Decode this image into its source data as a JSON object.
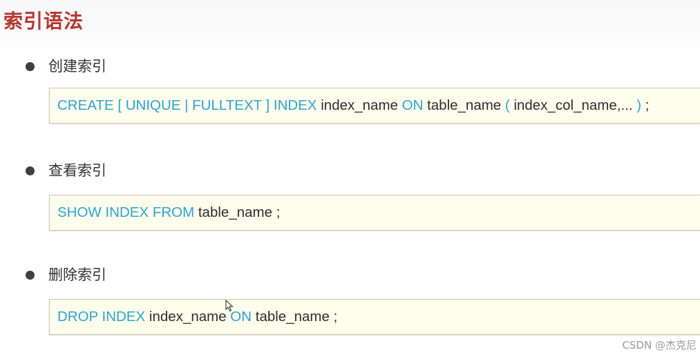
{
  "page": {
    "title": "索引语法",
    "title_color": "#b8352f",
    "keyword_color": "#26a5dc"
  },
  "sections": [
    {
      "label": "创建索引",
      "code": [
        {
          "t": "CREATE [ UNIQUE | FULLTEXT ] INDEX ",
          "kw": true
        },
        {
          "t": "index_name ",
          "kw": false
        },
        {
          "t": "ON ",
          "kw": true
        },
        {
          "t": "table_name ",
          "kw": false
        },
        {
          "t": "( ",
          "kw": true
        },
        {
          "t": "index_col_name,... ",
          "kw": false
        },
        {
          "t": ") ",
          "kw": true
        },
        {
          "t": ";",
          "kw": false
        }
      ]
    },
    {
      "label": "查看索引",
      "code": [
        {
          "t": "SHOW INDEX FROM ",
          "kw": true
        },
        {
          "t": "table_name ;",
          "kw": false
        }
      ]
    },
    {
      "label": "删除索引",
      "code": [
        {
          "t": "DROP INDEX ",
          "kw": true
        },
        {
          "t": "index_name ",
          "kw": false
        },
        {
          "t": "ON ",
          "kw": true
        },
        {
          "t": "table_name ;",
          "kw": false
        }
      ]
    }
  ],
  "cursor": {
    "icon": "mouse-pointer-icon"
  },
  "watermark": "CSDN @杰克尼"
}
